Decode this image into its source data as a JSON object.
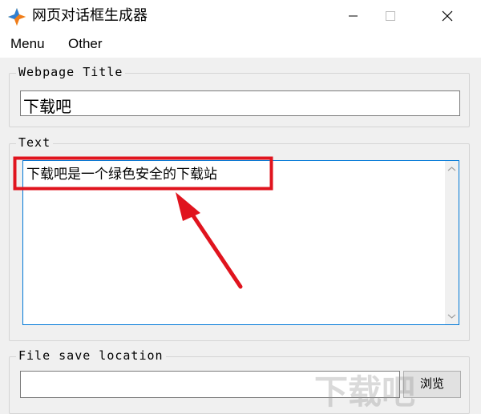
{
  "window": {
    "title": "网页对话框生成器"
  },
  "menu": {
    "items": [
      "Menu",
      "Other"
    ]
  },
  "webpage_title": {
    "legend": "Webpage Title",
    "value": "下载吧"
  },
  "text_section": {
    "legend": "Text",
    "value": "下载吧是一个绿色安全的下载站"
  },
  "file_save": {
    "legend": "File save location",
    "path_value": "",
    "browse_label": "浏览"
  },
  "watermark": {
    "text": "下载吧"
  },
  "colors": {
    "annotation_red": "#e0141e",
    "focus_blue": "#0078d7"
  }
}
